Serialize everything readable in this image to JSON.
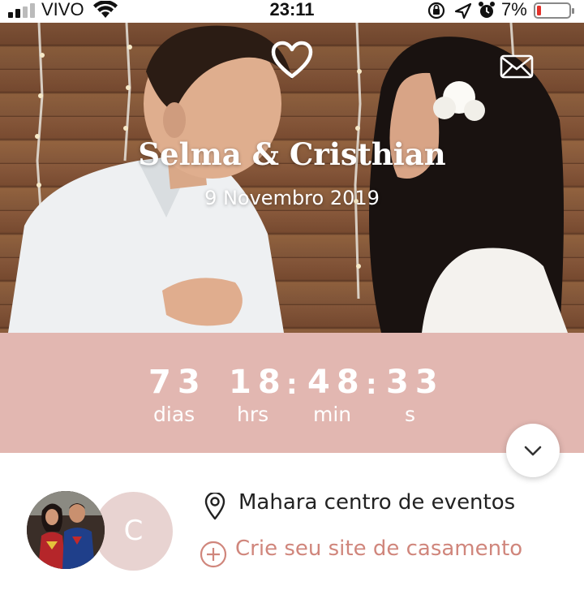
{
  "status_bar": {
    "carrier": "VIVO",
    "time": "23:11",
    "battery_percent": "7%",
    "icons": [
      "signal-icon",
      "wifi-icon",
      "orientation-lock-icon",
      "location-icon",
      "alarm-icon",
      "battery-icon"
    ]
  },
  "hero": {
    "couple_names": "Selma & Cristhian",
    "date": "9 Novembro 2019",
    "icons": [
      "heart-icon",
      "mail-icon"
    ]
  },
  "countdown": {
    "days": "73",
    "hours": "18",
    "minutes": "48",
    "seconds": "33",
    "days_label": "dias",
    "hours_label": "hrs",
    "minutes_label": "min",
    "seconds_label": "s",
    "separator": ":"
  },
  "info": {
    "avatar_letter": "C",
    "venue": "Mahara centro de eventos",
    "create_site": "Crie seu site de casamento"
  },
  "colors": {
    "countdown_bg": "#e2b7b1",
    "accent": "#d0867c",
    "avatar_placeholder": "#e8d3d1"
  }
}
